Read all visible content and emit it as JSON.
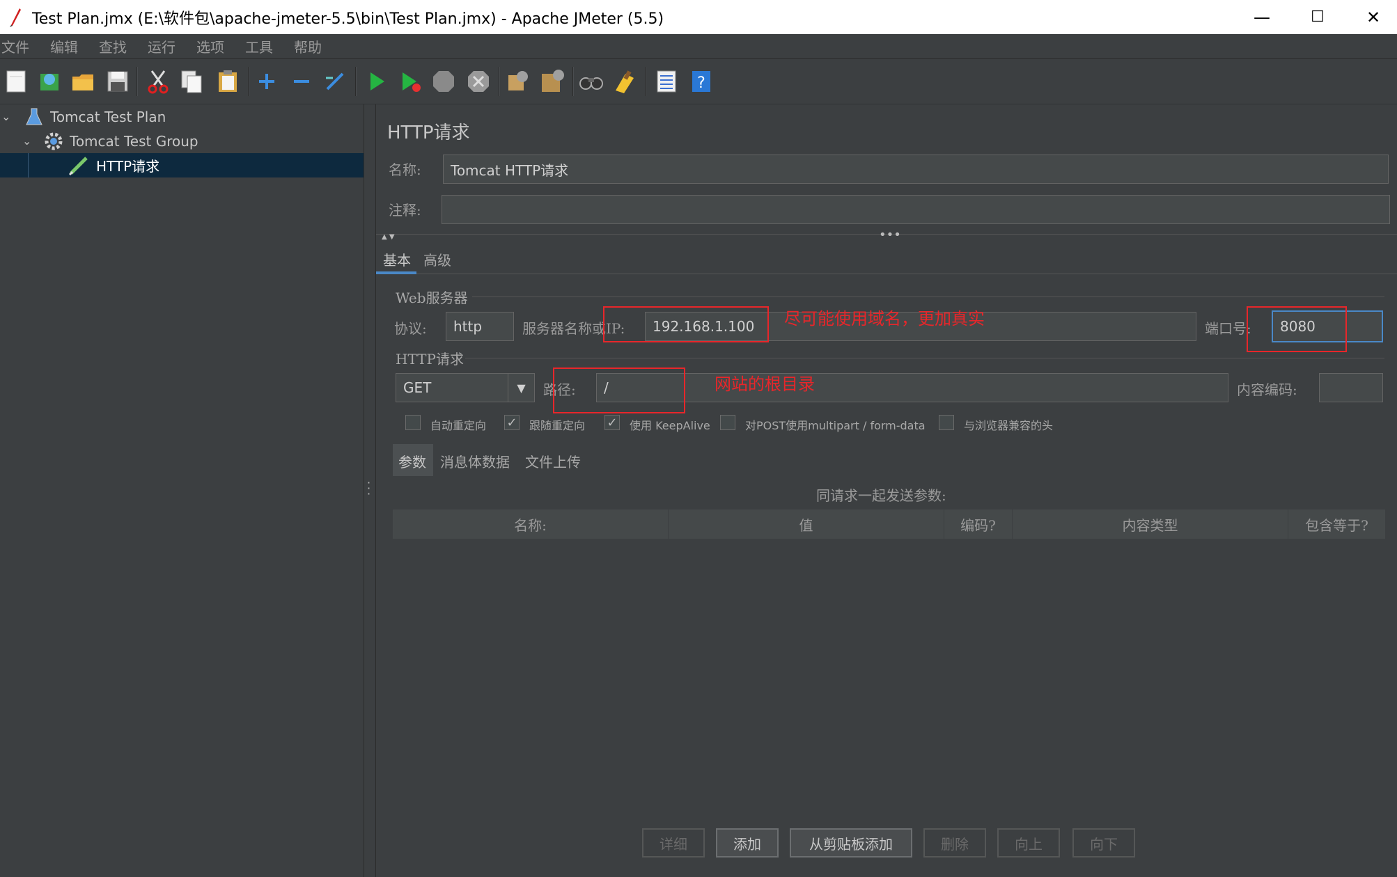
{
  "window": {
    "title": "Test Plan.jmx (E:\\软件包\\apache-jmeter-5.5\\bin\\Test Plan.jmx) - Apache JMeter (5.5)",
    "minimize": "—",
    "maximize": "☐",
    "close": "✕"
  },
  "menu": [
    "文件",
    "编辑",
    "查找",
    "运行",
    "选项",
    "工具",
    "帮助"
  ],
  "toolbar_icons": [
    "new-icon",
    "templates-icon",
    "open-icon",
    "save-icon",
    "cut-icon",
    "copy-icon",
    "paste-icon",
    "expand-icon",
    "collapse-icon",
    "toggle-icon",
    "start-icon",
    "start-no-pause-icon",
    "stop-icon",
    "shutdown-icon",
    "clear-icon",
    "clear-all-icon",
    "search-icon",
    "reset-search-icon",
    "function-helper-icon",
    "help-icon"
  ],
  "tree": [
    {
      "label": "Tomcat Test Plan",
      "icon": "test-plan-flask-icon",
      "level": 0
    },
    {
      "label": "Tomcat Test Group",
      "icon": "thread-group-gear-icon",
      "level": 1
    },
    {
      "label": "HTTP请求",
      "icon": "sampler-pen-icon",
      "level": 2,
      "selected": true
    }
  ],
  "panel": {
    "heading": "HTTP请求",
    "name_label": "名称:",
    "name_value": "Tomcat HTTP请求",
    "comment_label": "注释:",
    "comment_value": "",
    "tabs": [
      "基本",
      "高级"
    ],
    "web_server": {
      "legend": "Web服务器",
      "protocol_label": "协议:",
      "protocol_value": "http",
      "server_label": "服务器名称或IP:",
      "server_value": "192.168.1.100",
      "port_label": "端口号:",
      "port_value": "8080"
    },
    "http_request": {
      "legend": "HTTP请求",
      "method": "GET",
      "path_label": "路径:",
      "path_value": "/",
      "encoding_label": "内容编码:",
      "encoding_value": ""
    },
    "checkboxes": [
      {
        "label": "自动重定向",
        "checked": false
      },
      {
        "label": "跟随重定向",
        "checked": true
      },
      {
        "label": "使用 KeepAlive",
        "checked": true
      },
      {
        "label": "对POST使用multipart / form-data",
        "checked": false
      },
      {
        "label": "与浏览器兼容的头",
        "checked": false
      }
    ],
    "subtabs": [
      "参数",
      "消息体数据",
      "文件上传"
    ],
    "params_caption": "同请求一起发送参数:",
    "table_headers": [
      "名称:",
      "值",
      "编码?",
      "内容类型",
      "包含等于?"
    ],
    "buttons": [
      {
        "label": "详细",
        "enabled": false
      },
      {
        "label": "添加",
        "enabled": true
      },
      {
        "label": "从剪贴板添加",
        "enabled": true
      },
      {
        "label": "删除",
        "enabled": false
      },
      {
        "label": "向上",
        "enabled": false
      },
      {
        "label": "向下",
        "enabled": false
      }
    ]
  },
  "annotations": {
    "server_note": "尽可能使用域名，更加真实",
    "path_note": "网站的根目录"
  },
  "colors": {
    "background": "#3c3f41",
    "field": "#45494a",
    "selection": "#0d293e",
    "annotation_red": "#e8262a"
  }
}
